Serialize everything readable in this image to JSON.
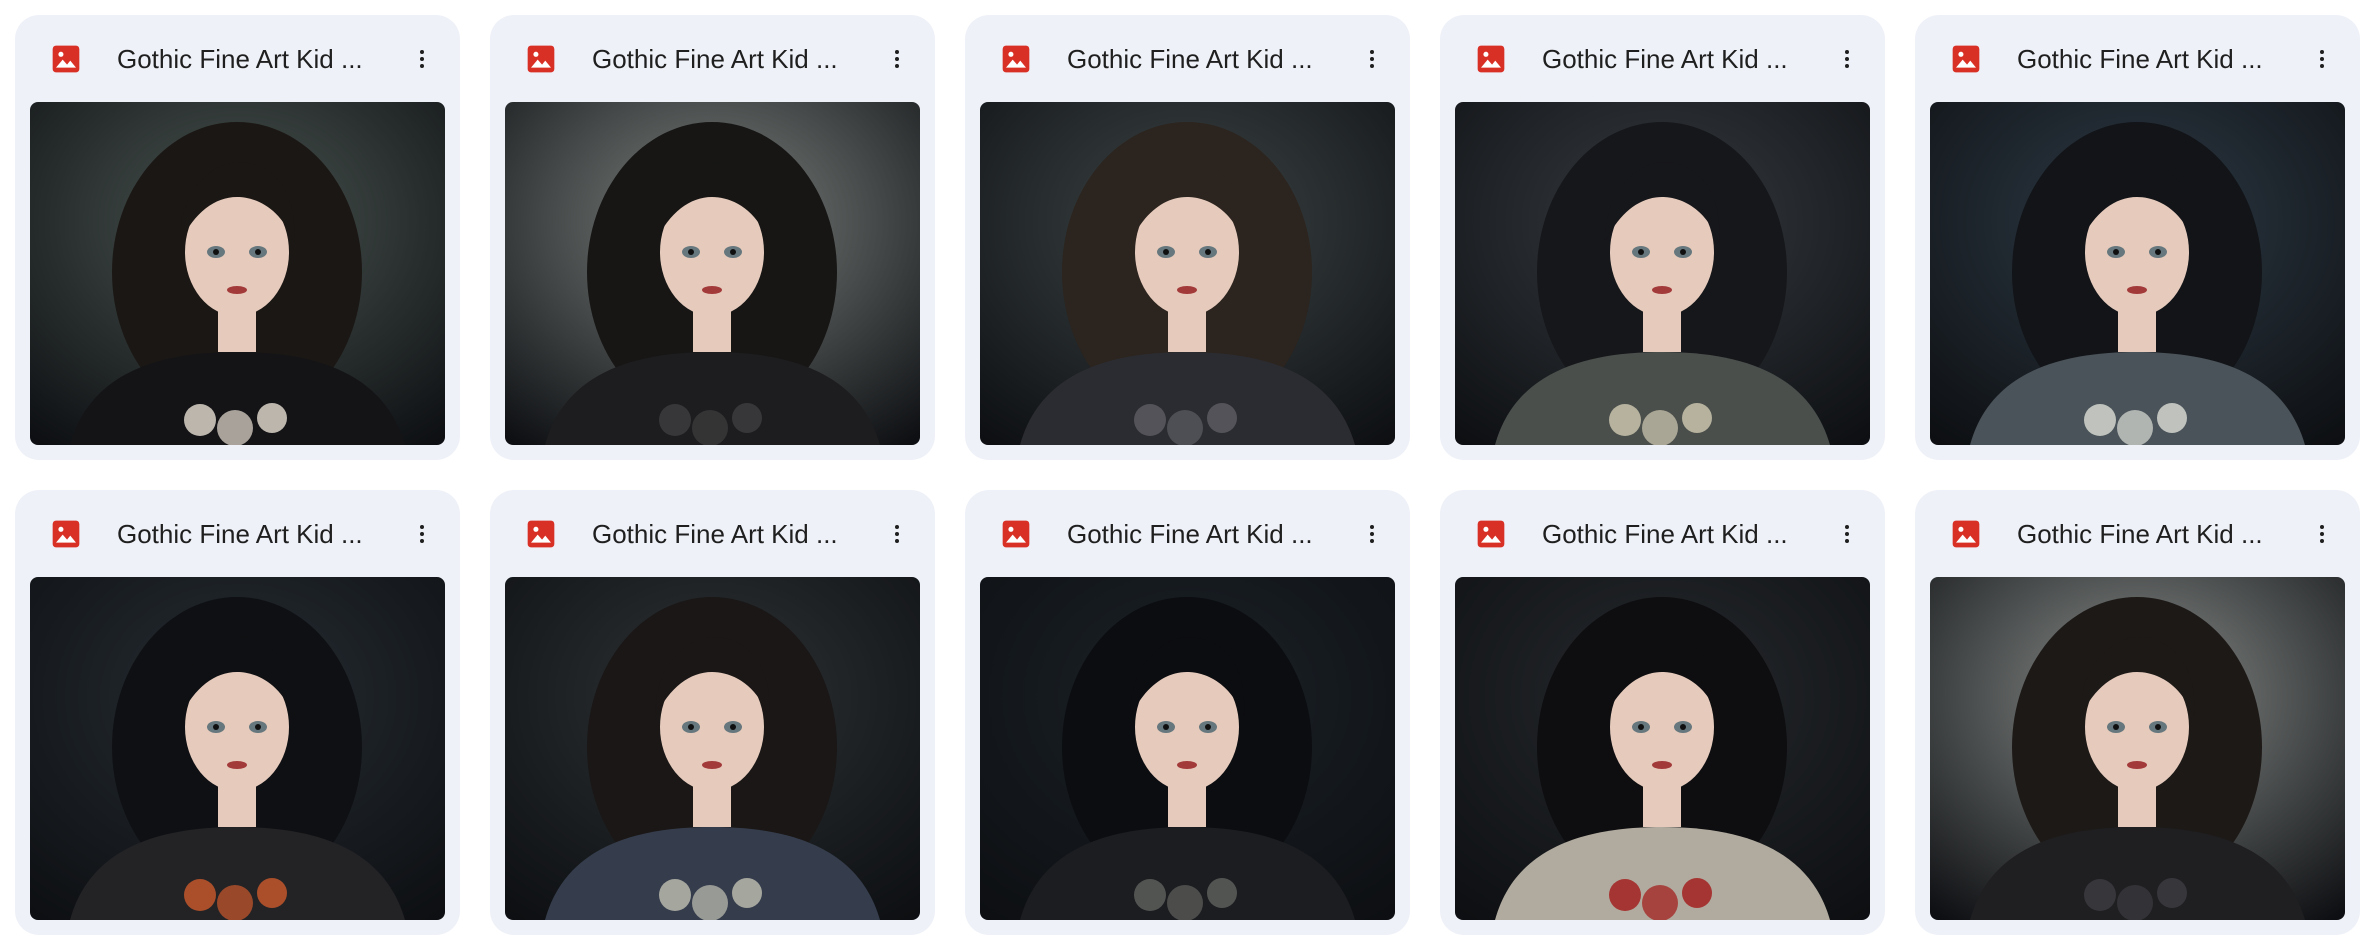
{
  "files": [
    {
      "name": "Gothic Fine Art Kid ...",
      "file_type_icon": "image-icon",
      "menu_icon": "more-vert-icon",
      "thumbnail": "portrait of a gothic girl with long curly dark hair, black bow and black dress",
      "colors": {
        "bg": "#4a5551",
        "hair": "#1b1714",
        "dress": "#141417",
        "accent": "#d9d2c8"
      }
    },
    {
      "name": "Gothic Fine Art Kid ...",
      "file_type_icon": "image-icon",
      "menu_icon": "more-vert-icon",
      "thumbnail": "portrait of a gothic girl with voluminous curly black hair",
      "colors": {
        "bg": "#7c827f",
        "hair": "#171615",
        "dress": "#1d1d1f",
        "accent": "#3c3c3e"
      }
    },
    {
      "name": "Gothic Fine Art Kid ...",
      "file_type_icon": "image-icon",
      "menu_icon": "more-vert-icon",
      "thumbnail": "portrait of a gothic girl with long brown curls, large black bow and ruffled collar",
      "colors": {
        "bg": "#3d4546",
        "hair": "#2c241e",
        "dress": "#2b2c31",
        "accent": "#5a5b60"
      }
    },
    {
      "name": "Gothic Fine Art Kid ...",
      "file_type_icon": "image-icon",
      "menu_icon": "more-vert-icon",
      "thumbnail": "portrait of a gothic girl with dark hair holding pale roses",
      "colors": {
        "bg": "#363b40",
        "hair": "#16171a",
        "dress": "#4a4f4c",
        "accent": "#c9c3ad"
      }
    },
    {
      "name": "Gothic Fine Art Kid ...",
      "file_type_icon": "image-icon",
      "menu_icon": "more-vert-icon",
      "thumbnail": "portrait of a gothic girl with messy black hair holding white roses",
      "colors": {
        "bg": "#2d3a45",
        "hair": "#121418",
        "dress": "#4a5359",
        "accent": "#d3d6cf"
      }
    },
    {
      "name": "Gothic Fine Art Kid ...",
      "file_type_icon": "image-icon",
      "menu_icon": "more-vert-icon",
      "thumbnail": "portrait of a gothic girl with long black hair, puffed sleeves and flowers",
      "colors": {
        "bg": "#262d33",
        "hair": "#0f1013",
        "dress": "#232326",
        "accent": "#c2572c"
      }
    },
    {
      "name": "Gothic Fine Art Kid ...",
      "file_type_icon": "image-icon",
      "menu_icon": "more-vert-icon",
      "thumbnail": "portrait of a gothic girl with curly dark hair in a blue-grey dress holding roses",
      "colors": {
        "bg": "#2d3234",
        "hair": "#1a1716",
        "dress": "#353d4c",
        "accent": "#b9b9ad"
      }
    },
    {
      "name": "Gothic Fine Art Kid ...",
      "file_type_icon": "image-icon",
      "menu_icon": "more-vert-icon",
      "thumbnail": "portrait of a gothic girl with black hair and dark collar",
      "colors": {
        "bg": "#1b2228",
        "hair": "#0c0d10",
        "dress": "#1c1d21",
        "accent": "#5c5e5a"
      }
    },
    {
      "name": "Gothic Fine Art Kid ...",
      "file_type_icon": "image-icon",
      "menu_icon": "more-vert-icon",
      "thumbnail": "portrait of a gothic girl with bangs, headband, light dress and red roses",
      "colors": {
        "bg": "#26292d",
        "hair": "#0e0e10",
        "dress": "#b1ab9f",
        "accent": "#a3201e"
      }
    },
    {
      "name": "Gothic Fine Art Kid ...",
      "file_type_icon": "image-icon",
      "menu_icon": "more-vert-icon",
      "thumbnail": "portrait of a gothic girl with long wavy dark hair on a grey background",
      "colors": {
        "bg": "#8a8e8b",
        "hair": "#1d1917",
        "dress": "#1f1f22",
        "accent": "#3b3b3f"
      }
    }
  ],
  "theme": {
    "card_bg": "#eef1f8",
    "icon_red": "#d93025",
    "text": "#1f1f1f",
    "menu_dots": "#1f1f1f",
    "skin": "#e6cbbd",
    "lips": "#a33a3a",
    "eyes": "#66777d"
  }
}
